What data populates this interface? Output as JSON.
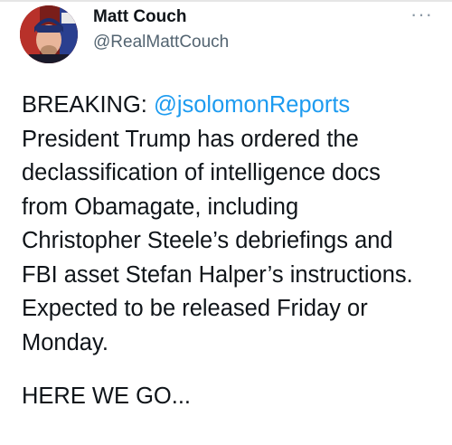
{
  "author": {
    "name": "Matt Couch",
    "handle": "@RealMattCouch",
    "avatar_icon": "profile-photo"
  },
  "menu": {
    "more_icon": "more-horizontal-icon",
    "more_glyph": "···"
  },
  "tweet": {
    "prefix": "BREAKING: ",
    "mention": "@jsolomonReports",
    "lines": [
      "President Trump has ordered the",
      "declassification of intelligence docs",
      "from Obamagate, including",
      "Christopher Steele’s debriefings and",
      "FBI asset Stefan Halper’s instructions.",
      "Expected to be released Friday or",
      "Monday."
    ],
    "closing": "HERE WE GO..."
  },
  "colors": {
    "text": "#0f1419",
    "secondary": "#536471",
    "link": "#1d9bf0"
  }
}
